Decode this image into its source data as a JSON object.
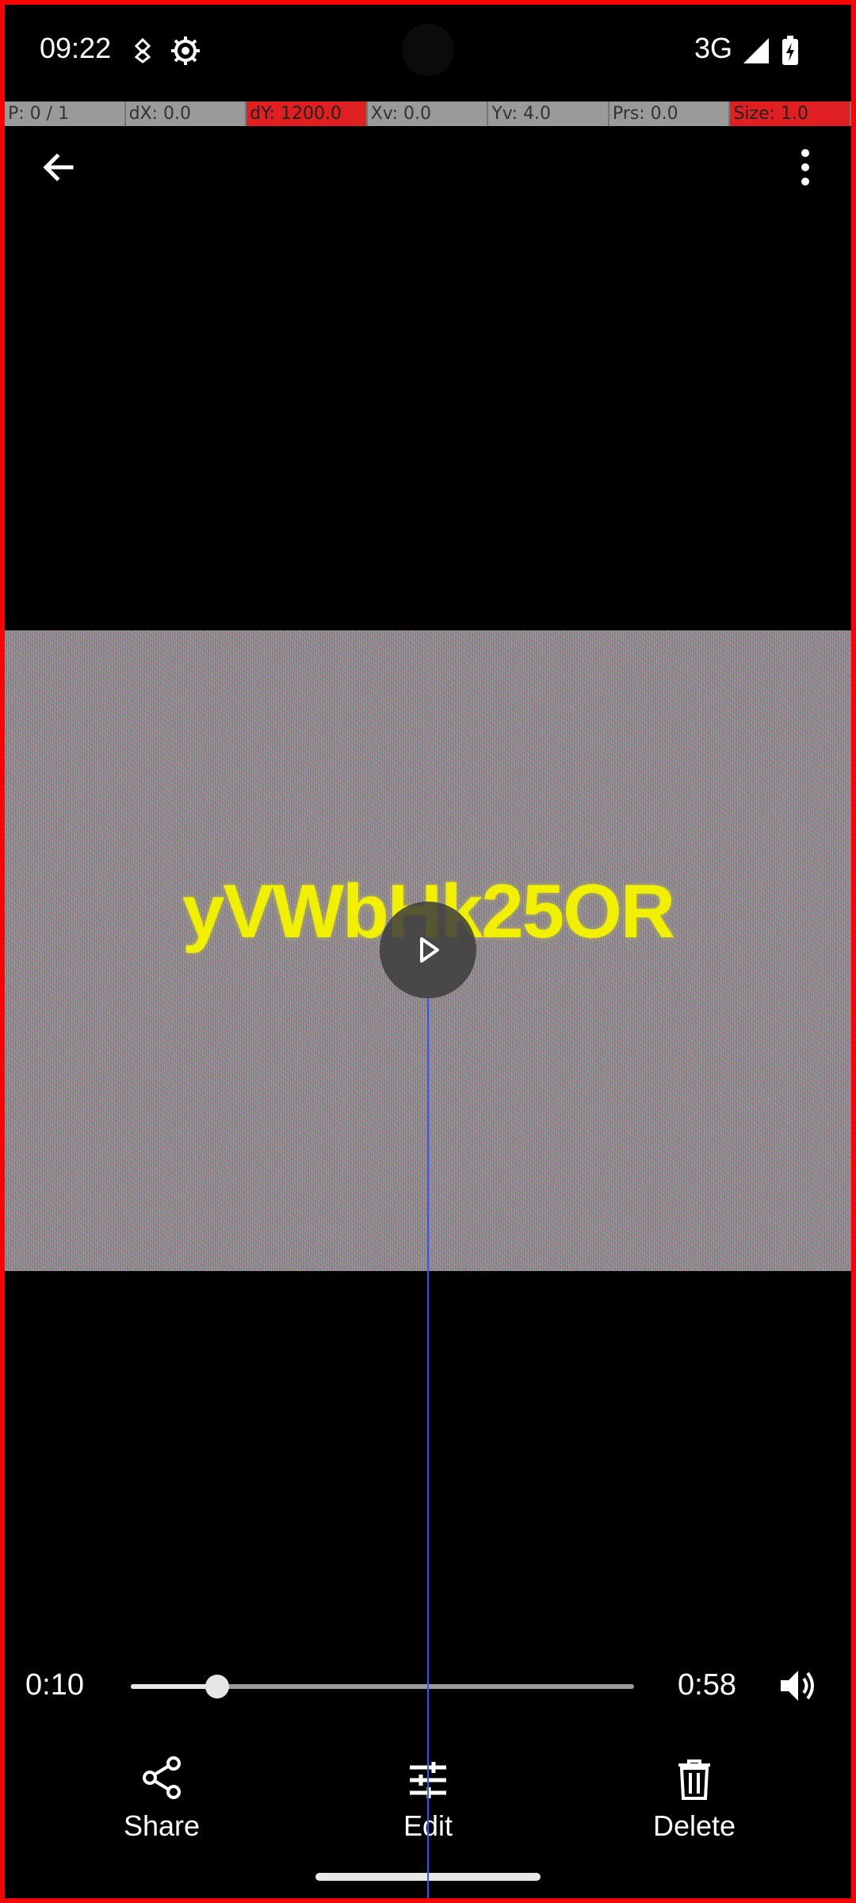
{
  "status_bar": {
    "time": "09:22",
    "icons": [
      "usb-debug-icon",
      "gear-icon",
      "signal-icon",
      "battery-charging-icon"
    ],
    "network": "3G"
  },
  "pointer_location": {
    "cells": [
      "P: 0 / 1",
      "dX: 0.0",
      "dY: 1200.0",
      "Xv: 0.0",
      "Yv: 4.0",
      "Prs: 0.0",
      "Size: 1.0"
    ]
  },
  "top_bar": {
    "icons": [
      "back-arrow-icon",
      "more-vert-icon"
    ]
  },
  "video": {
    "caption": "yVWbHk25OR"
  },
  "player": {
    "elapsed": "0:10",
    "duration": "0:58",
    "progress": 0.172,
    "icons": [
      "play-icon",
      "volume-icon"
    ]
  },
  "actions": {
    "share": "Share",
    "edit": "Edit",
    "delete": "Delete"
  },
  "colors": {
    "background": "#000000",
    "border": "#ff0000",
    "caption": "#f0f000",
    "touch_line": "#3a50ff"
  }
}
